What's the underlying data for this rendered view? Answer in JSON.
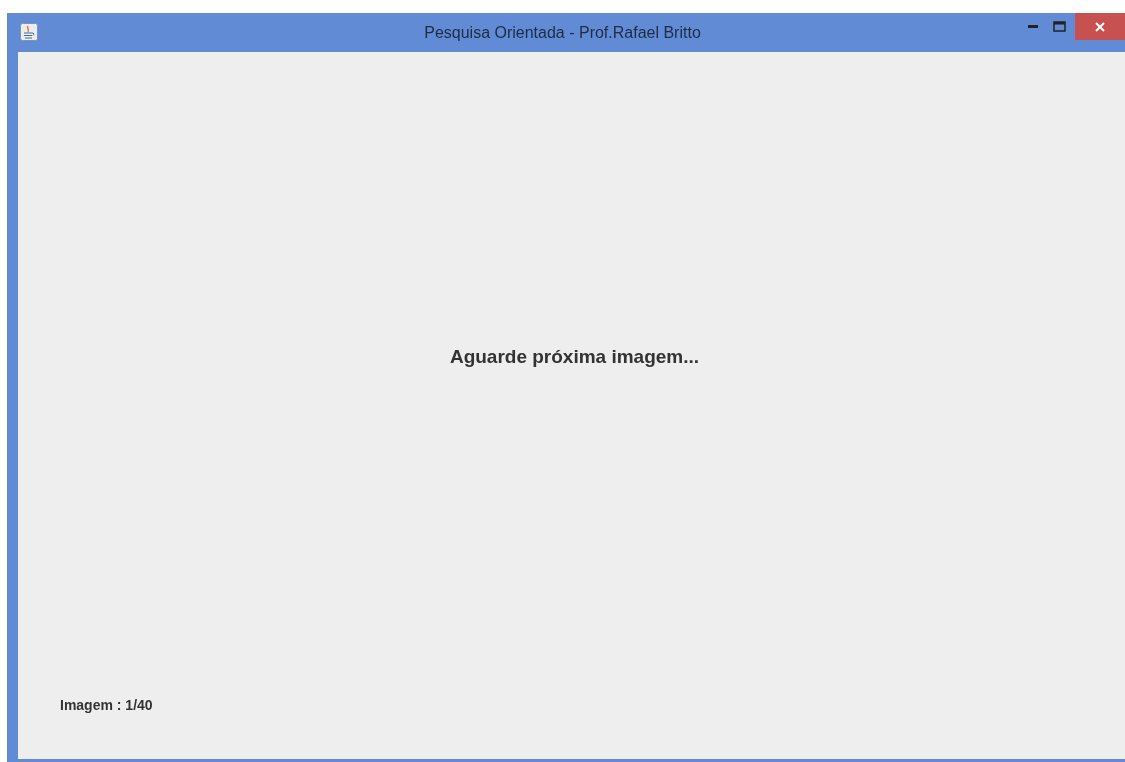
{
  "window": {
    "title": "Pesquisa Orientada - Prof.Rafael Britto"
  },
  "content": {
    "message": "Aguarde próxima imagem...",
    "counter_label": "Imagem :",
    "counter_value": "1/40"
  }
}
